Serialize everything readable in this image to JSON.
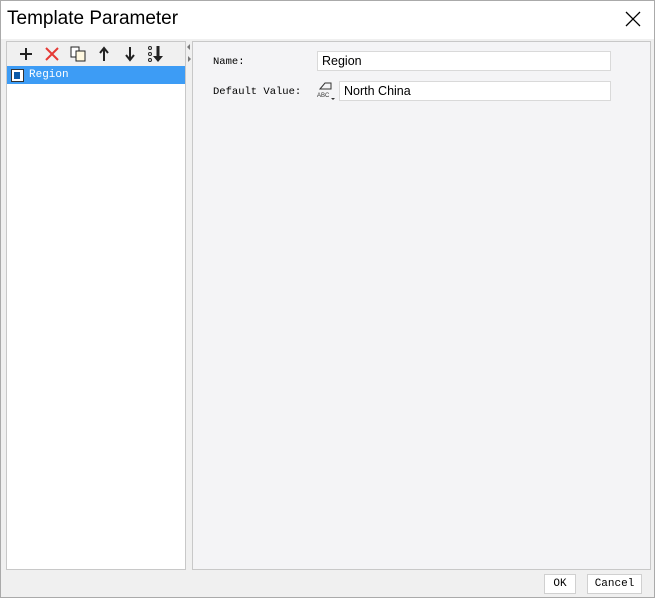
{
  "window": {
    "title": "Template Parameter"
  },
  "toolbar": {
    "icons": [
      "plus-icon",
      "delete-icon",
      "copy-icon",
      "arrow-up-icon",
      "arrow-down-icon",
      "move-bottom-icon"
    ]
  },
  "params": [
    {
      "label": "Region"
    }
  ],
  "form": {
    "name_label": "Name:",
    "name_value": "Region",
    "default_label": "Default Value:",
    "default_value": "North China",
    "type_icon_text": "ABC"
  },
  "footer": {
    "ok": "OK",
    "cancel": "Cancel"
  }
}
